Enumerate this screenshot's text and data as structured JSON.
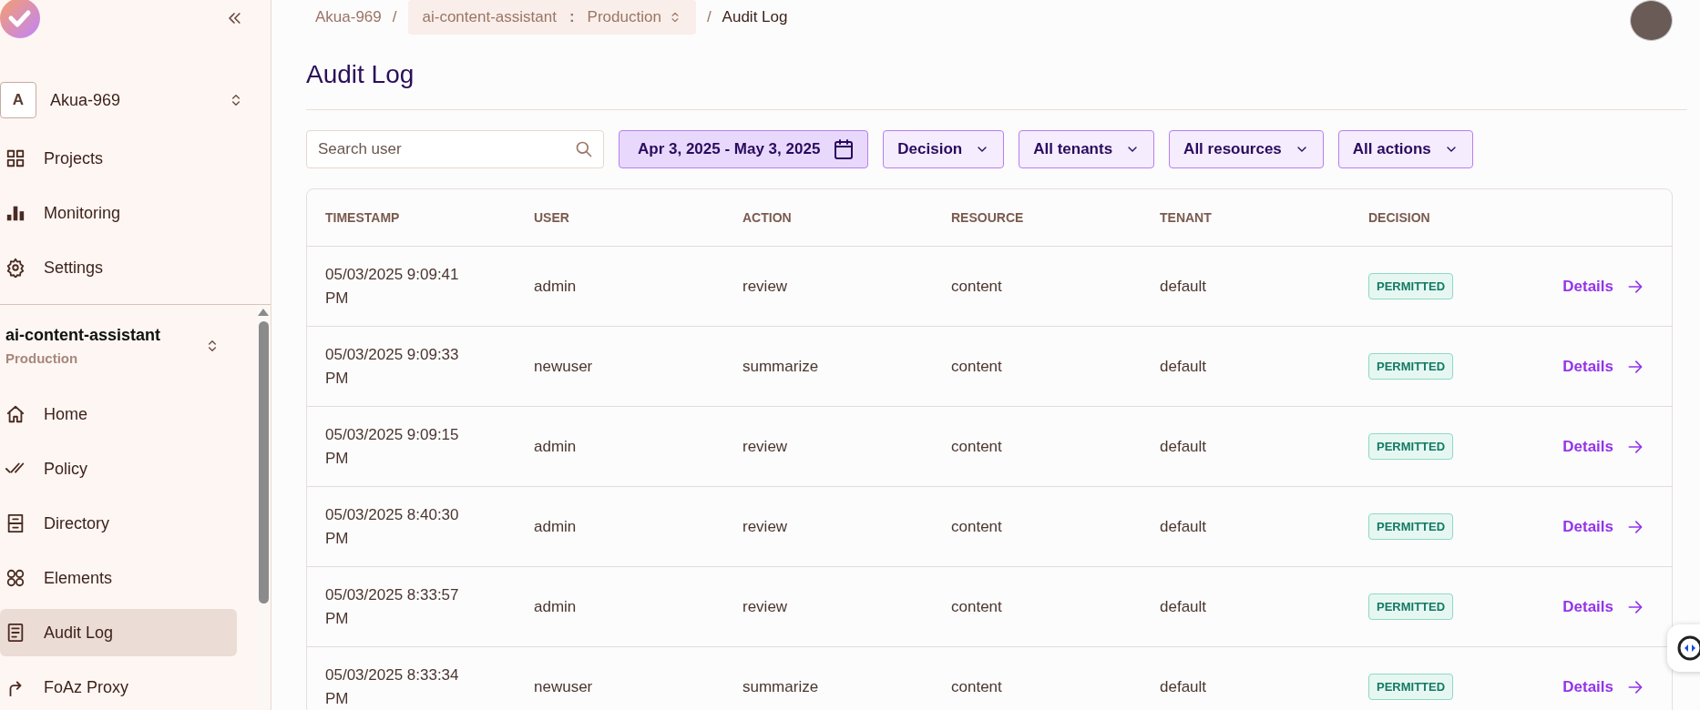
{
  "sidebar": {
    "organization": {
      "initial": "A",
      "name": "Akua-969"
    },
    "nav_items": [
      {
        "label": "Projects",
        "selected": false
      },
      {
        "label": "Monitoring",
        "selected": false
      },
      {
        "label": "Settings",
        "selected": false
      }
    ],
    "project": {
      "name": "ai-content-assistant",
      "environment": "Production"
    },
    "project_nav": [
      {
        "label": "Home",
        "selected": false
      },
      {
        "label": "Policy",
        "selected": false
      },
      {
        "label": "Directory",
        "selected": false
      },
      {
        "label": "Elements",
        "selected": false
      },
      {
        "label": "Audit Log",
        "selected": true
      },
      {
        "label": "FoAz Proxy",
        "selected": false
      }
    ]
  },
  "breadcrumb": {
    "organization": "Akua-969",
    "separator": "/",
    "project": "ai-content-assistant",
    "divider": ":",
    "environment": "Production",
    "separator_2": "/",
    "current": "Audit Log"
  },
  "page_title": "Audit Log",
  "filters": {
    "search": {
      "placeholder": "Search user"
    },
    "date_range": "Apr 3, 2025 - May 3, 2025",
    "dropdowns": [
      "Decision",
      "All tenants",
      "All resources",
      "All actions"
    ]
  },
  "table": {
    "columns": [
      "TIMESTAMP",
      "USER",
      "ACTION",
      "RESOURCE",
      "TENANT",
      "DECISION"
    ],
    "rows": [
      {
        "timestamp": "05/03/2025 9:09:41 PM",
        "user": "admin",
        "action": "review",
        "resource": "content",
        "tenant": "default",
        "decision": "PERMITTED",
        "link": "Details"
      },
      {
        "timestamp": "05/03/2025 9:09:33 PM",
        "user": "newuser",
        "action": "summarize",
        "resource": "content",
        "tenant": "default",
        "decision": "PERMITTED",
        "link": "Details"
      },
      {
        "timestamp": "05/03/2025 9:09:15 PM",
        "user": "admin",
        "action": "review",
        "resource": "content",
        "tenant": "default",
        "decision": "PERMITTED",
        "link": "Details"
      },
      {
        "timestamp": "05/03/2025 8:40:30 PM",
        "user": "admin",
        "action": "review",
        "resource": "content",
        "tenant": "default",
        "decision": "PERMITTED",
        "link": "Details"
      },
      {
        "timestamp": "05/03/2025 8:33:57 PM",
        "user": "admin",
        "action": "review",
        "resource": "content",
        "tenant": "default",
        "decision": "PERMITTED",
        "link": "Details"
      },
      {
        "timestamp": "05/03/2025 8:33:34 PM",
        "user": "newuser",
        "action": "summarize",
        "resource": "content",
        "tenant": "default",
        "decision": "PERMITTED",
        "link": "Details"
      }
    ]
  }
}
